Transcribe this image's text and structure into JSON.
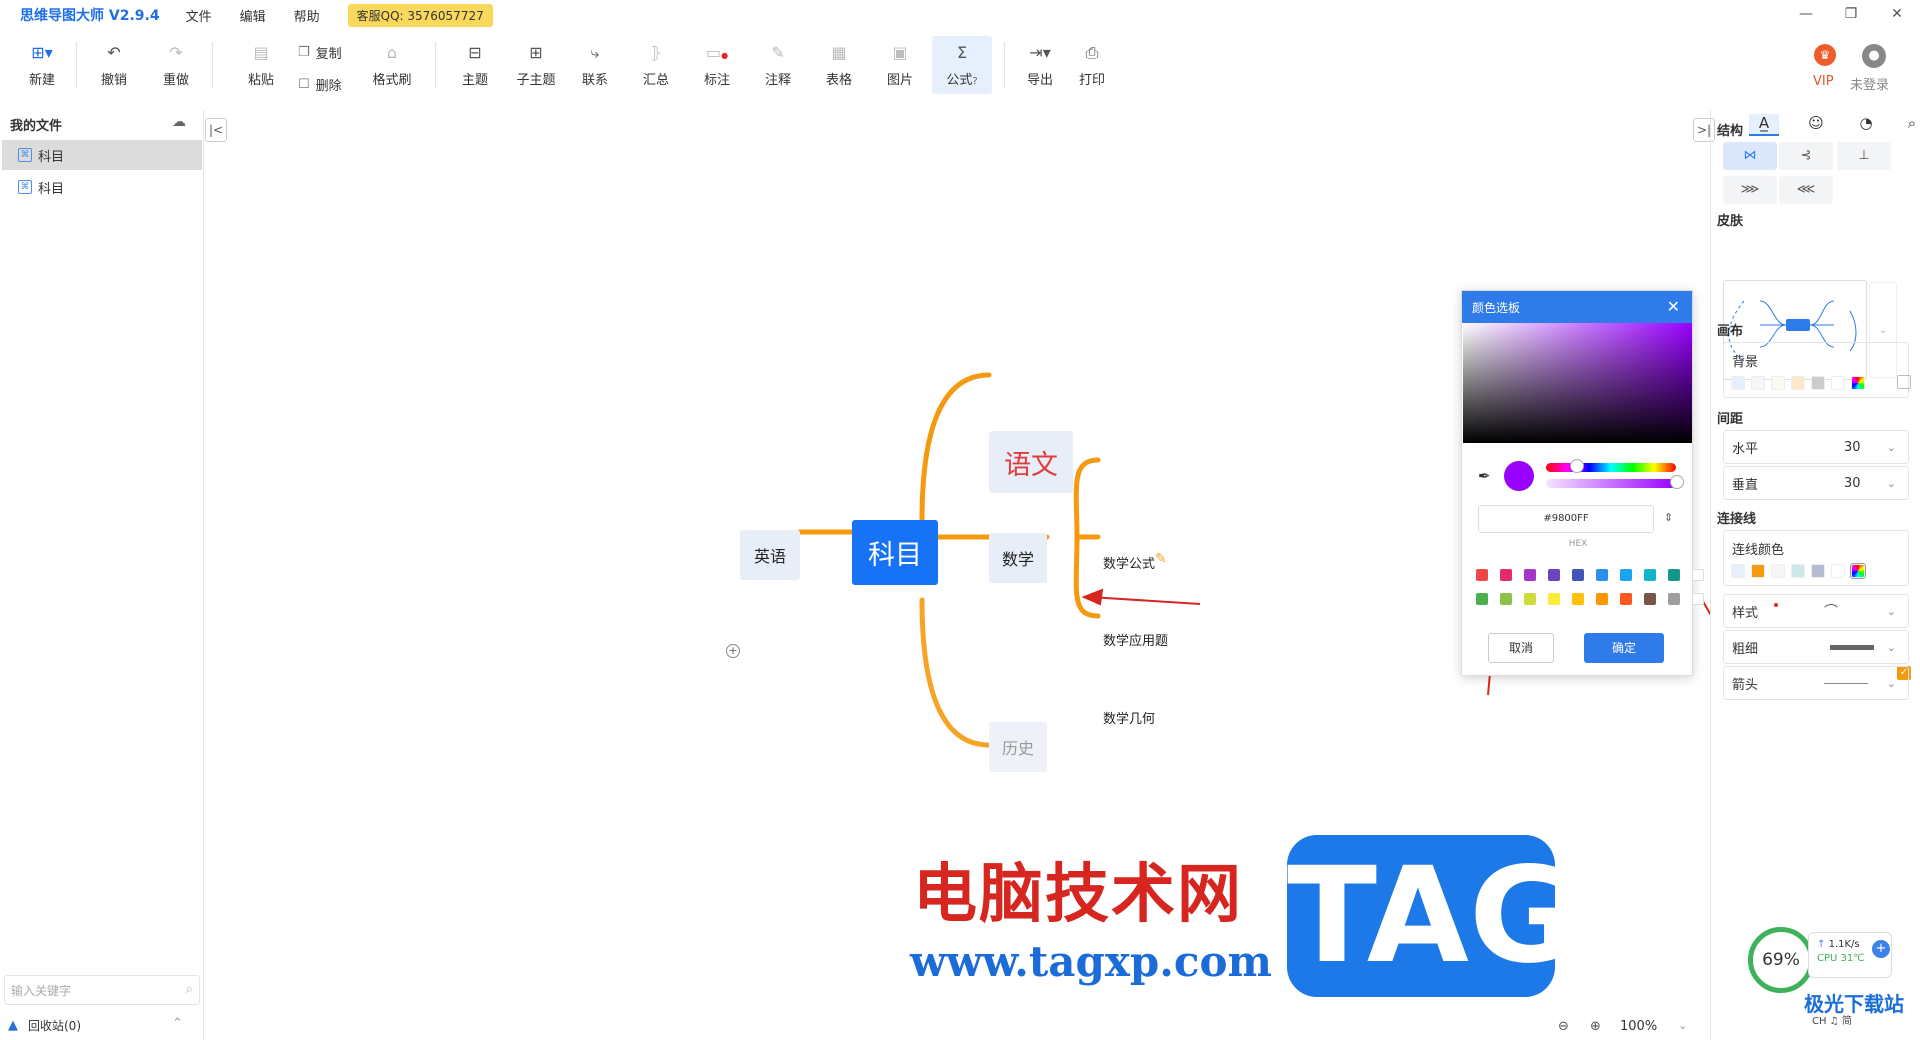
{
  "app": {
    "title": "思维导图大师 V2.9.4"
  },
  "menu": {
    "file": "文件",
    "edit": "编辑",
    "help": "帮助",
    "qq": "客服QQ: 3576057727"
  },
  "toolbar": {
    "new": "新建",
    "undo": "撤销",
    "redo": "重做",
    "paste": "粘贴",
    "copy": "复制",
    "delete": "删除",
    "format_brush": "格式刷",
    "topic": "主题",
    "subtopic": "子主题",
    "link": "联系",
    "summary": "汇总",
    "mark": "标注",
    "note": "注释",
    "table": "表格",
    "image": "图片",
    "formula": "公式",
    "export": "导出",
    "print": "打印"
  },
  "account": {
    "vip": "VIP",
    "user": "未登录"
  },
  "sidebar": {
    "title": "我的文件",
    "files": [
      "科目",
      "科目"
    ],
    "search_placeholder": "输入关键字",
    "recycle": "回收站(0)"
  },
  "mindmap": {
    "root": "科目",
    "chinese": "语文",
    "math": "数学",
    "english": "英语",
    "history": "历史",
    "math_children": [
      "数学公式",
      "数学应用题",
      "数学几何"
    ],
    "branch_color": "#f5990e"
  },
  "picker": {
    "title": "颜色选板",
    "hex": "#9800FF",
    "hex_label": "HEX",
    "cancel": "取消",
    "ok": "确定",
    "current_color": "#9800ff",
    "presets": [
      "#f04848",
      "#e32b6b",
      "#a436c8",
      "#6c44c2",
      "#3f55b8",
      "#2b8ff0",
      "#1aa3ee",
      "#12b5cc",
      "#14968a",
      "#ffffff",
      "#4caf50",
      "#8bc34a",
      "#cddc39",
      "#ffeb3b",
      "#ffc107",
      "#ff9800",
      "#ff5722",
      "#795548",
      "#9e9e9e",
      "#ffffff"
    ]
  },
  "panel": {
    "structure": "结构",
    "skin": "皮肤",
    "canvas": "画布",
    "background": "背景",
    "spacing": "间距",
    "horizontal": "水平",
    "horizontal_val": "30",
    "vertical": "垂直",
    "vertical_val": "30",
    "connector": "连接线",
    "line_color": "连线颜色",
    "style": "样式",
    "thickness": "粗细",
    "arrow": "箭头"
  },
  "status": {
    "zoom": "100%"
  },
  "watermark": {
    "text": "电脑技术网",
    "url": "www.tagxp.com",
    "tag": "TAG"
  },
  "widget": {
    "percent": "69%",
    "speed": "1.1K/s",
    "cpu": "CPU 31℃",
    "logo": "极光下载站",
    "sub": "CH ♫ 简"
  }
}
